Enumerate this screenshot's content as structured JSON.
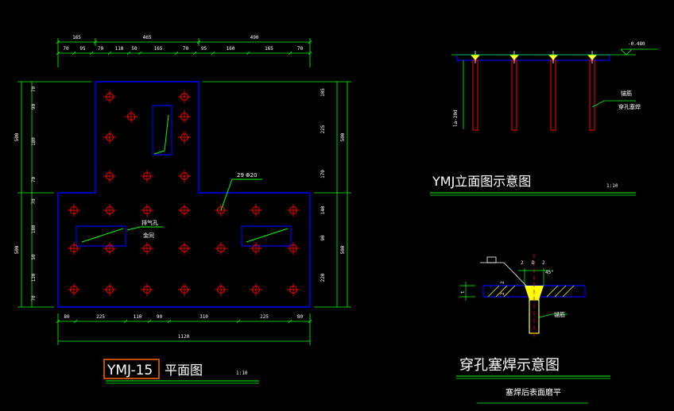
{
  "plan": {
    "title_code": "YMJ-15",
    "title_text": "平面图",
    "scale": "1:10",
    "top_dims_1": [
      "165",
      "465",
      "490"
    ],
    "top_dims_2": [
      "70",
      "95",
      "70",
      "110",
      "50",
      "165",
      "70",
      "95",
      "160",
      "165",
      "70"
    ],
    "bottom_dims_1": [
      "80",
      "225",
      "110",
      "90",
      "310",
      "225",
      "80"
    ],
    "bottom_total": "1120",
    "left_dims_1": [
      "500",
      "500"
    ],
    "left_dims_2": [
      "70",
      "90",
      "180",
      "70",
      "70",
      "180",
      "50",
      "130",
      "70"
    ],
    "right_dims_1": [
      "500",
      "500"
    ],
    "right_dims_2": [
      "105",
      "225",
      "170",
      "140",
      "90",
      "220"
    ],
    "rebar_label": "29 Φ20",
    "vent_label_1": "排气孔",
    "vent_label_2": "金同"
  },
  "elevation": {
    "title": "YMJ立面图示意图",
    "scale": "1:10",
    "level": "-0.480",
    "anchor_len": "la-20d",
    "note_1": "锚筋",
    "note_2": "穿孔塞焊"
  },
  "weld": {
    "title": "穿孔塞焊示意图",
    "note": "塞焊后表面磨平",
    "bar_label": "锚筋",
    "dims": [
      "2",
      "D",
      "2"
    ],
    "angle": "45°",
    "side_dims": [
      "2",
      "2"
    ],
    "t_label": "t"
  },
  "colors": {
    "background": "#000000",
    "outline": "#0000ff",
    "dimension": "#00ff00",
    "rebar": "#ff0000",
    "leader": "#00ff00",
    "title_box": "#ff6600"
  }
}
